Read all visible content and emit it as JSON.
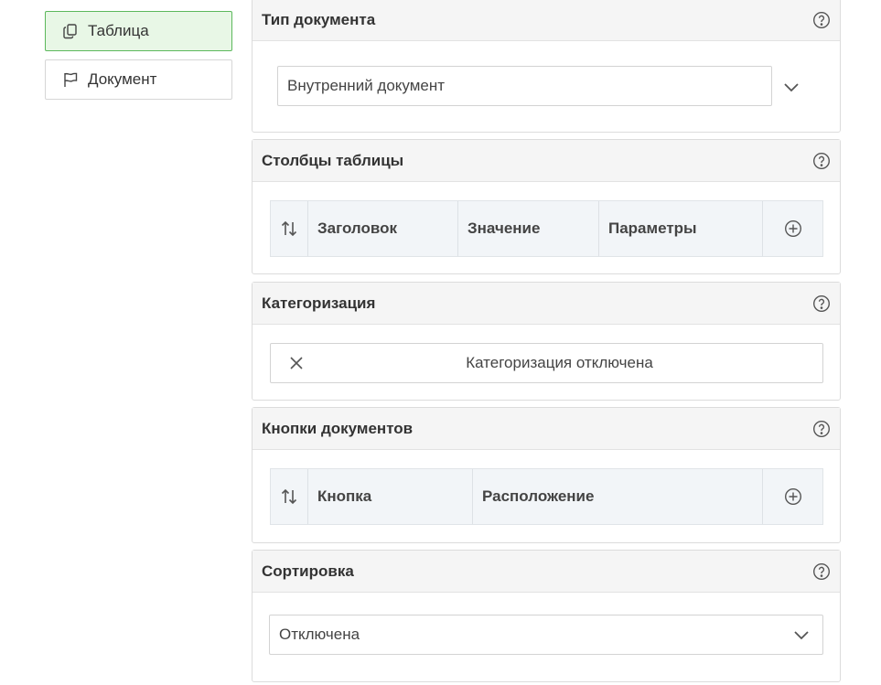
{
  "nav": {
    "items": [
      {
        "label": "Таблица",
        "icon": "copy-icon",
        "active": true
      },
      {
        "label": "Документ",
        "icon": "flag-icon",
        "active": false
      }
    ]
  },
  "panels": {
    "doc_type": {
      "title": "Тип документа",
      "selected": "Внутренний документ"
    },
    "columns": {
      "title": "Столбцы таблицы",
      "headers": [
        "Заголовок",
        "Значение",
        "Параметры"
      ]
    },
    "categorization": {
      "title": "Категоризация",
      "toggle_label": "Категоризация отключена"
    },
    "doc_buttons": {
      "title": "Кнопки документов",
      "headers": [
        "Кнопка",
        "Расположение"
      ]
    },
    "sorting": {
      "title": "Сортировка",
      "selected": "Отключена"
    }
  },
  "colors": {
    "active_bg": "#e8f7e6",
    "active_border": "#5cb85c",
    "panel_header_bg": "#f5f5f5",
    "table_header_bg": "#f2f5f8"
  }
}
